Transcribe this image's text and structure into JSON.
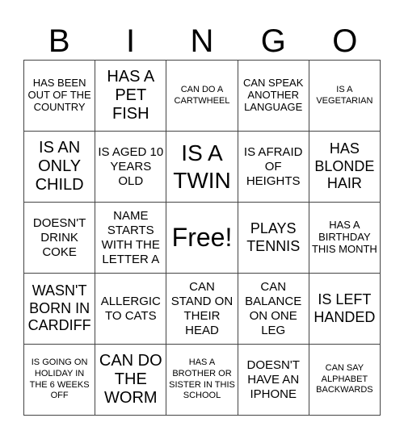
{
  "header": [
    "B",
    "I",
    "N",
    "G",
    "O"
  ],
  "cells": [
    [
      "HAS BEEN OUT OF THE COUNTRY",
      "HAS A PET FISH",
      "CAN DO A CARTWHEEL",
      "CAN SPEAK ANOTHER LANGUAGE",
      "IS A VEGETARIAN"
    ],
    [
      "IS AN ONLY CHILD",
      "IS AGED 10 YEARS OLD",
      "IS A TWIN",
      "IS AFRAID OF HEIGHTS",
      "HAS BLONDE HAIR"
    ],
    [
      "DOESN'T DRINK COKE",
      "NAME STARTS WITH THE LETTER A",
      "Free!",
      "PLAYS TENNIS",
      "HAS A BIRTHDAY THIS MONTH"
    ],
    [
      "WASN'T BORN IN CARDIFF",
      "ALLERGIC TO CATS",
      "CAN STAND ON THEIR HEAD",
      "CAN BALANCE ON ONE LEG",
      "IS LEFT HANDED"
    ],
    [
      "IS GOING ON HOLIDAY IN THE 6 WEEKS OFF",
      "CAN DO THE WORM",
      "HAS A BROTHER OR SISTER IN THIS SCHOOL",
      "DOESN'T HAVE AN IPHONE",
      "CAN SAY ALPHABET BACKWARDS"
    ]
  ]
}
